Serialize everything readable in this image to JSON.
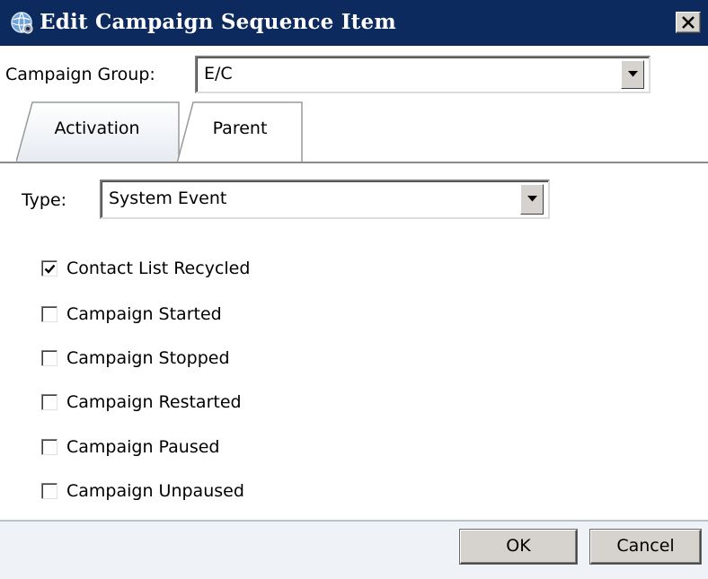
{
  "window": {
    "title": "Edit Campaign Sequence Item",
    "icon": "globe-gear-icon",
    "close_icon": "close-x-icon"
  },
  "campaign_group": {
    "label": "Campaign Group:",
    "value": "E/C"
  },
  "tabs": [
    {
      "label": "Activation",
      "active": false
    },
    {
      "label": "Parent",
      "active": true
    }
  ],
  "type": {
    "label": "Type:",
    "value": "System Event"
  },
  "events": [
    {
      "label": "Contact List Recycled",
      "checked": true
    },
    {
      "label": "Campaign Started",
      "checked": false
    },
    {
      "label": "Campaign Stopped",
      "checked": false
    },
    {
      "label": "Campaign Restarted",
      "checked": false
    },
    {
      "label": "Campaign Paused",
      "checked": false
    },
    {
      "label": "Campaign Unpaused",
      "checked": false
    }
  ],
  "buttons": {
    "ok": "OK",
    "cancel": "Cancel"
  },
  "colors": {
    "titlebar": "#0c2a5d",
    "button_face": "#d6d3ce",
    "footer": "#eff2f6"
  }
}
